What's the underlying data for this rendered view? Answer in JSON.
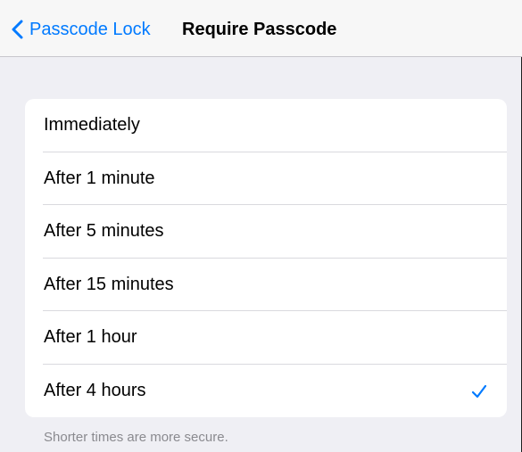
{
  "nav": {
    "back_label": "Passcode Lock",
    "title": "Require Passcode"
  },
  "options": [
    {
      "label": "Immediately",
      "selected": false
    },
    {
      "label": "After 1 minute",
      "selected": false
    },
    {
      "label": "After 5 minutes",
      "selected": false
    },
    {
      "label": "After 15 minutes",
      "selected": false
    },
    {
      "label": "After 1 hour",
      "selected": false
    },
    {
      "label": "After 4 hours",
      "selected": true
    }
  ],
  "footer": "Shorter times are more secure.",
  "colors": {
    "accent": "#007aff",
    "background": "#efeff4"
  },
  "icons": {
    "back": "chevron-left-icon",
    "selected": "checkmark-icon"
  }
}
